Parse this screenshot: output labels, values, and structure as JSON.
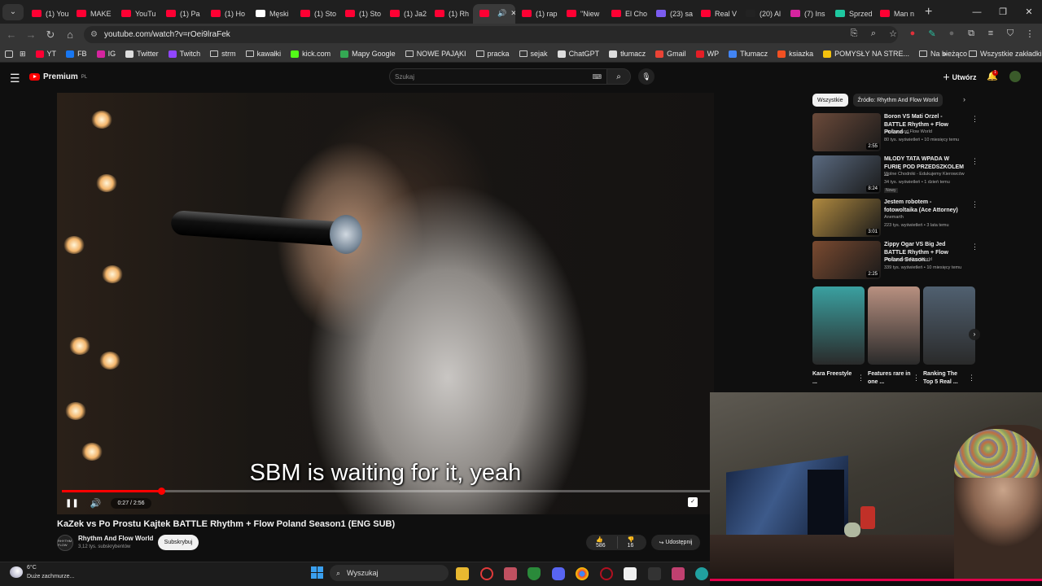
{
  "browser": {
    "tabs": [
      {
        "label": "(1) You",
        "color": "#ff0033"
      },
      {
        "label": "MAKE",
        "color": "#ff0033"
      },
      {
        "label": "YouTu",
        "color": "#ff0033"
      },
      {
        "label": "(1) Pa",
        "color": "#ff0033"
      },
      {
        "label": "(1) Ho",
        "color": "#ff0033"
      },
      {
        "label": "Męski",
        "color": "#ffffff"
      },
      {
        "label": "(1) Sto",
        "color": "#ff0033"
      },
      {
        "label": "(1) Sto",
        "color": "#ff0033"
      },
      {
        "label": "(1) Ja2",
        "color": "#ff0033"
      },
      {
        "label": "(1) Rh",
        "color": "#ff0033"
      },
      {
        "label": "",
        "color": "#ff0033",
        "active": true
      },
      {
        "label": "(1) rap",
        "color": "#ff0033"
      },
      {
        "label": "\"Niew",
        "color": "#ff0033"
      },
      {
        "label": "El Cho",
        "color": "#ff0033"
      },
      {
        "label": "(23) sa",
        "color": "#7b5cf0"
      },
      {
        "label": "Real V",
        "color": "#ff0033"
      },
      {
        "label": "(20) Al",
        "color": "#222222"
      },
      {
        "label": "(7) Ins",
        "color": "#d6249f"
      },
      {
        "label": "Sprzed",
        "color": "#1ec8a0"
      },
      {
        "label": "Man n",
        "color": "#ff0033"
      }
    ],
    "url": "youtube.com/watch?v=rOei9lraFek",
    "bookmarks": [
      {
        "label": "YT",
        "color": "#ff0033"
      },
      {
        "label": "FB",
        "color": "#1877f2"
      },
      {
        "label": "IG",
        "color": "#d6249f"
      },
      {
        "label": "Twitter",
        "color": "#dddddd"
      },
      {
        "label": "Twitch",
        "color": "#9146ff"
      },
      {
        "label": "strm",
        "folder": true
      },
      {
        "label": "kawałki",
        "folder": true
      },
      {
        "label": "kick.com",
        "color": "#53fc18"
      },
      {
        "label": "Mapy Google",
        "color": "#34a853"
      },
      {
        "label": "NOWE PAJĄKI",
        "folder": true
      },
      {
        "label": "pracka",
        "folder": true
      },
      {
        "label": "sejak",
        "folder": true
      },
      {
        "label": "ChatGPT",
        "color": "#dddddd"
      },
      {
        "label": "tłumacz",
        "color": "#dddddd"
      },
      {
        "label": "Gmail",
        "color": "#ea4335"
      },
      {
        "label": "WP",
        "color": "#e41e26"
      },
      {
        "label": "Tłumacz",
        "color": "#4285f4"
      },
      {
        "label": "ksiazka",
        "color": "#f25022"
      },
      {
        "label": "POMYSŁY NA STRE...",
        "color": "#f4c20d"
      },
      {
        "label": "Na bieżąco",
        "folder": true
      }
    ],
    "all_bookmarks": "Wszystkie zakładki"
  },
  "youtube": {
    "logo": "Premium",
    "logo_sup": "PL",
    "search_placeholder": "Szukaj",
    "create": "Utwórz",
    "notifications": "1",
    "video": {
      "subtitle": "SBM is waiting for it, yeah",
      "time": "0:27 / 2:56",
      "progress": 0.153,
      "title": "KaZek vs Po Prostu Kajtek BATTLE Rhythm + Flow Poland Season1 (ENG SUB)",
      "channel": "Rhythm And Flow World",
      "subscribers": "3,12 tys. subskrybentów",
      "subscribe": "Subskrybuj",
      "likes": "586",
      "dislikes": "16",
      "share": "Udostępnij",
      "channel_avatar_text": "RHYTHM FLOW"
    },
    "chips": [
      "Wszystkie",
      "Źródło: Rhythm And Flow World"
    ],
    "recommendations": [
      {
        "title": "Boron VS Mati Orzel - BATTLE Rhythm + Flow Poland ...",
        "channel": "Rhythm And Flow World",
        "stats": "80 tys. wyświetleń • 10 miesięcy temu",
        "duration": "2:55",
        "color": "#6b4a3a"
      },
      {
        "title": "MŁODY TATA WPADA W FURIĘ POD PRZEDSZKOLEM ...",
        "channel": "Wolne Chodniki - Edukujemy Kierowców",
        "stats": "34 tys. wyświetleń • 1 dzień temu",
        "duration": "8:24",
        "badge": "Nowy",
        "color": "#5a6a80"
      },
      {
        "title": "Jestem robotem - fotowoltaika (Ace Attorney)",
        "channel": "Anemarth",
        "stats": "223 tys. wyświetleń • 3 lata temu",
        "duration": "3:01",
        "color": "#b08a40"
      },
      {
        "title": "Zippy Ogar VS Big Jed BATTLE Rhythm + Flow Poland Season...",
        "channel": "Rhythm And Flow World",
        "stats": "339 tys. wyświetleń • 10 miesięcy temu",
        "duration": "2:25",
        "color": "#7a4a30"
      }
    ],
    "shorts": [
      {
        "title": "Kara Freestyle ...",
        "color": "#3aa0a0"
      },
      {
        "title": "Features rare in one ...",
        "color": "#b89080"
      },
      {
        "title": "Ranking The Top 5 Real ...",
        "color": "#506070"
      }
    ]
  },
  "taskbar": {
    "temperature": "6°C",
    "weather": "Duże zachmurze...",
    "search": "Wyszukaj"
  }
}
